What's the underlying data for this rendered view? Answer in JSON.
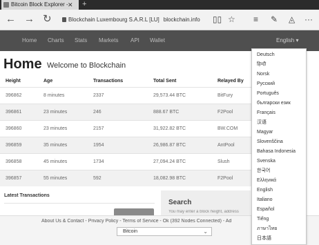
{
  "browser": {
    "tab_title": "Bitcoin Block Explorer -",
    "tab_close": "✕",
    "new_tab": "+",
    "back_icon": "←",
    "forward_icon": "→",
    "refresh_icon": "↻",
    "cert_owner": "Blockchain Luxembourg S.A.R.L [LU]",
    "domain": "blockchain.info",
    "reading_view_icon": "▯▯",
    "favorite_icon": "☆",
    "hub_icon": "≡",
    "notes_icon": "✎",
    "share_icon": "◬",
    "more_icon": "···"
  },
  "site_nav": {
    "links": [
      "Home",
      "Charts",
      "Stats",
      "Markets",
      "API",
      "Wallet"
    ],
    "language": "English ▾"
  },
  "heading": {
    "title": "Home",
    "subtitle": "Welcome to Blockchain"
  },
  "blocks_table": {
    "headers": [
      "Height",
      "Age",
      "Transactions",
      "Total Sent",
      "Relayed By"
    ],
    "rows": [
      [
        "396862",
        "8 minutes",
        "2337",
        "29,573.44 BTC",
        "BitFury"
      ],
      [
        "396861",
        "23 minutes",
        "246",
        "888.67 BTC",
        "F2Pool"
      ],
      [
        "396860",
        "23 minutes",
        "2157",
        "31,922.82 BTC",
        "BW.COM"
      ],
      [
        "396859",
        "35 minutes",
        "1954",
        "26,986.87 BTC",
        "AntPool"
      ],
      [
        "396858",
        "45 minutes",
        "1734",
        "27,094.24 BTC",
        "Slush"
      ],
      [
        "396857",
        "55 minutes",
        "592",
        "18,082.98 BTC",
        "F2Pool"
      ]
    ]
  },
  "latest_transactions": {
    "title": "Latest Transactions"
  },
  "search": {
    "title": "Search",
    "hint": "You may enter a block height, address"
  },
  "footer": {
    "text": "About Us & Contact - Privacy Policy - Terms of Service - Ok (392 Nodes Connected) - Ad",
    "currency": "Bitcoin",
    "chevron": "⌄"
  },
  "languages": [
    "Deutsch",
    "हिन्दी",
    "Norsk",
    "Русский",
    "Português",
    "български език",
    "Français",
    "汉语",
    "Magyar",
    "Slovenščina",
    "Bahasa Indonesia",
    "Svenska",
    "한국어",
    "Ελληνικά",
    "English",
    "Italiano",
    "Español",
    "Tiếng",
    "ภาษาไทย",
    "日本語"
  ]
}
